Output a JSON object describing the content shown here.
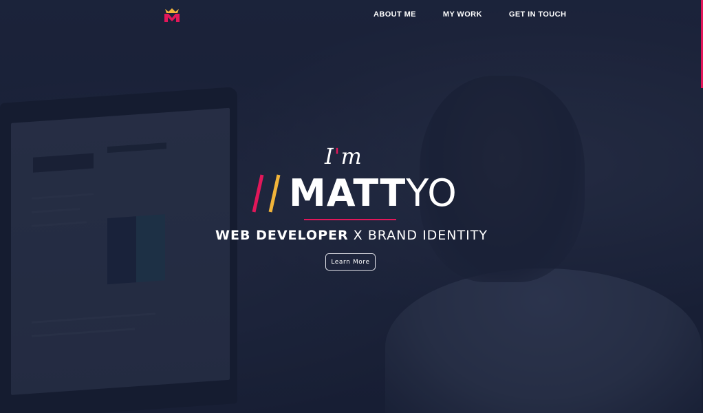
{
  "nav": {
    "logo_icon": "m-crown-logo",
    "links": [
      "ABOUT ME",
      "MY WORK",
      "GET IN TOUCH"
    ]
  },
  "hero": {
    "greeting_prefix": "I",
    "greeting_apostrophe": "'",
    "greeting_suffix": "m",
    "name_bold": "MATT",
    "name_light": "YO",
    "tagline_bold": "WEB DEVELOPER",
    "tagline_rest": " X BRAND IDENTITY",
    "cta_label": "Learn More"
  },
  "colors": {
    "accent_pink": "#e2175a",
    "accent_yellow": "#f2b43a",
    "background": "#1b2236",
    "text": "#ffffff"
  }
}
